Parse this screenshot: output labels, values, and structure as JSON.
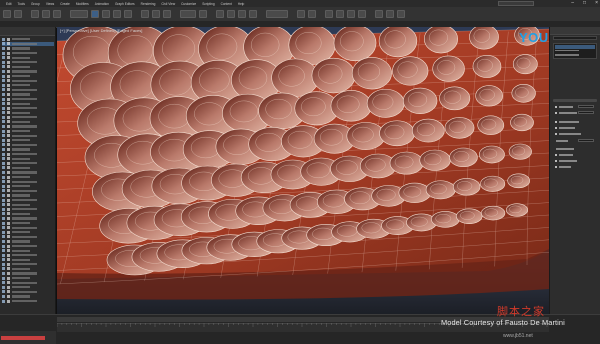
{
  "app": {
    "menubar": [
      "Edit",
      "Tools",
      "Group",
      "Views",
      "Create",
      "Modifiers",
      "Animation",
      "Graph Editors",
      "Rendering",
      "Civil View",
      "Customize",
      "Scripting",
      "Content",
      "Help"
    ],
    "window_controls": [
      "–",
      "□",
      "×"
    ]
  },
  "viewport": {
    "label": "[+] [Perspective] [User Defined] [Edged Faces]",
    "mesh_color": "#b4402a",
    "background_color": "#2f3850",
    "hole_interior_color": "#c8917a"
  },
  "watermark": {
    "brand": "YOUKU",
    "site_text": "脚本之家",
    "site_url": "www.jb51.net"
  },
  "credit": {
    "text": "Model Courtesy of Fausto De Martini"
  },
  "scene_explorer": {
    "row_count": 58,
    "selected_row_index": 1
  },
  "command_panel": {
    "selected_item_index": 0
  },
  "colors": {
    "ui_dark": "#2a2a2a",
    "selection_blue": "#3b5a7c",
    "accent_red": "#d23a2a",
    "youku_blue": "#1ea0e8"
  }
}
